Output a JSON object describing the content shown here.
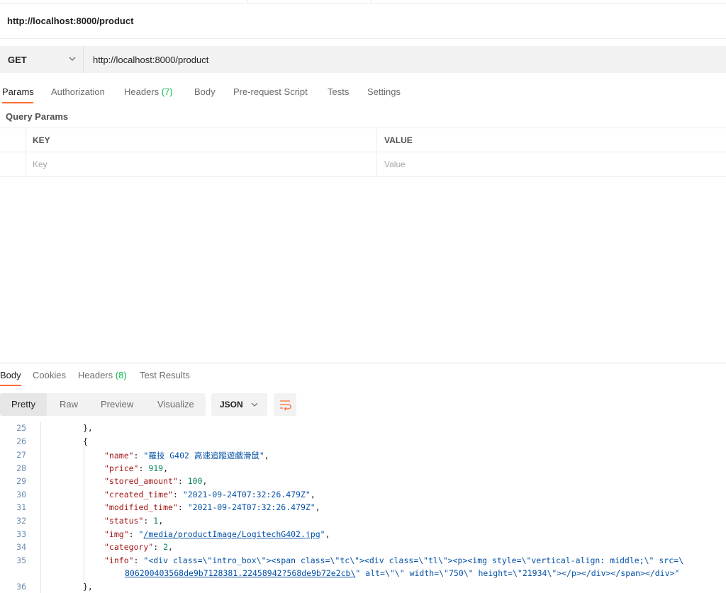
{
  "request": {
    "title": "http://localhost:8000/product",
    "method": "GET",
    "url": "http://localhost:8000/product"
  },
  "request_tabs": [
    {
      "label": "Params"
    },
    {
      "label": "Authorization"
    },
    {
      "label": "Headers",
      "count": "(7)"
    },
    {
      "label": "Body"
    },
    {
      "label": "Pre-request Script"
    },
    {
      "label": "Tests"
    },
    {
      "label": "Settings"
    }
  ],
  "query_params": {
    "title": "Query Params",
    "key_header": "KEY",
    "value_header": "VALUE",
    "key_placeholder": "Key",
    "value_placeholder": "Value"
  },
  "response_tabs": [
    {
      "label": "Body"
    },
    {
      "label": "Cookies"
    },
    {
      "label": "Headers",
      "count": "(8)"
    },
    {
      "label": "Test Results"
    }
  ],
  "view_modes": [
    "Pretty",
    "Raw",
    "Preview",
    "Visualize"
  ],
  "format": "JSON",
  "code": {
    "line_numbers": [
      "25",
      "26",
      "27",
      "28",
      "29",
      "30",
      "31",
      "32",
      "33",
      "34",
      "35",
      "36"
    ],
    "l25": "},",
    "l26": "{",
    "l27": {
      "key": "\"name\"",
      "value": "\"羅技 G402 高速追蹤遊戲滑鼠\""
    },
    "l28": {
      "key": "\"price\"",
      "value": "919"
    },
    "l29": {
      "key": "\"stored_amount\"",
      "value": "100"
    },
    "l30": {
      "key": "\"created_time\"",
      "value": "\"2021-09-24T07:32:26.479Z\""
    },
    "l31": {
      "key": "\"modified_time\"",
      "value": "\"2021-09-24T07:32:26.479Z\""
    },
    "l32": {
      "key": "\"status\"",
      "value": "1"
    },
    "l33": {
      "key": "\"img\"",
      "value_open": "\"",
      "value_link": "/media/productImage/LogitechG402.jpg",
      "value_close": "\""
    },
    "l34": {
      "key": "\"category\"",
      "value": "2"
    },
    "l35": {
      "key": "\"info\"",
      "value_a": "\"<div class=\\\"intro_box\\\"><span class=\\\"tc\\\"><div class=\\\"tl\\\"><p><img style=\\\"vertical-align: middle;\\\" src=\\",
      "value_link": "806200403568de9b7128381.22458942?568de9b72e2cb\\",
      "value_b": "\" alt=\\\"\\\" width=\\\"750\\\" height=\\\"21934\\\"></p></div></span></div>\""
    },
    "l36": "},"
  },
  "colors": {
    "accent": "#ff6c37",
    "count": "#0cbb52",
    "json_key": "#a31515",
    "json_string": "#0451a5",
    "json_number": "#098658"
  }
}
